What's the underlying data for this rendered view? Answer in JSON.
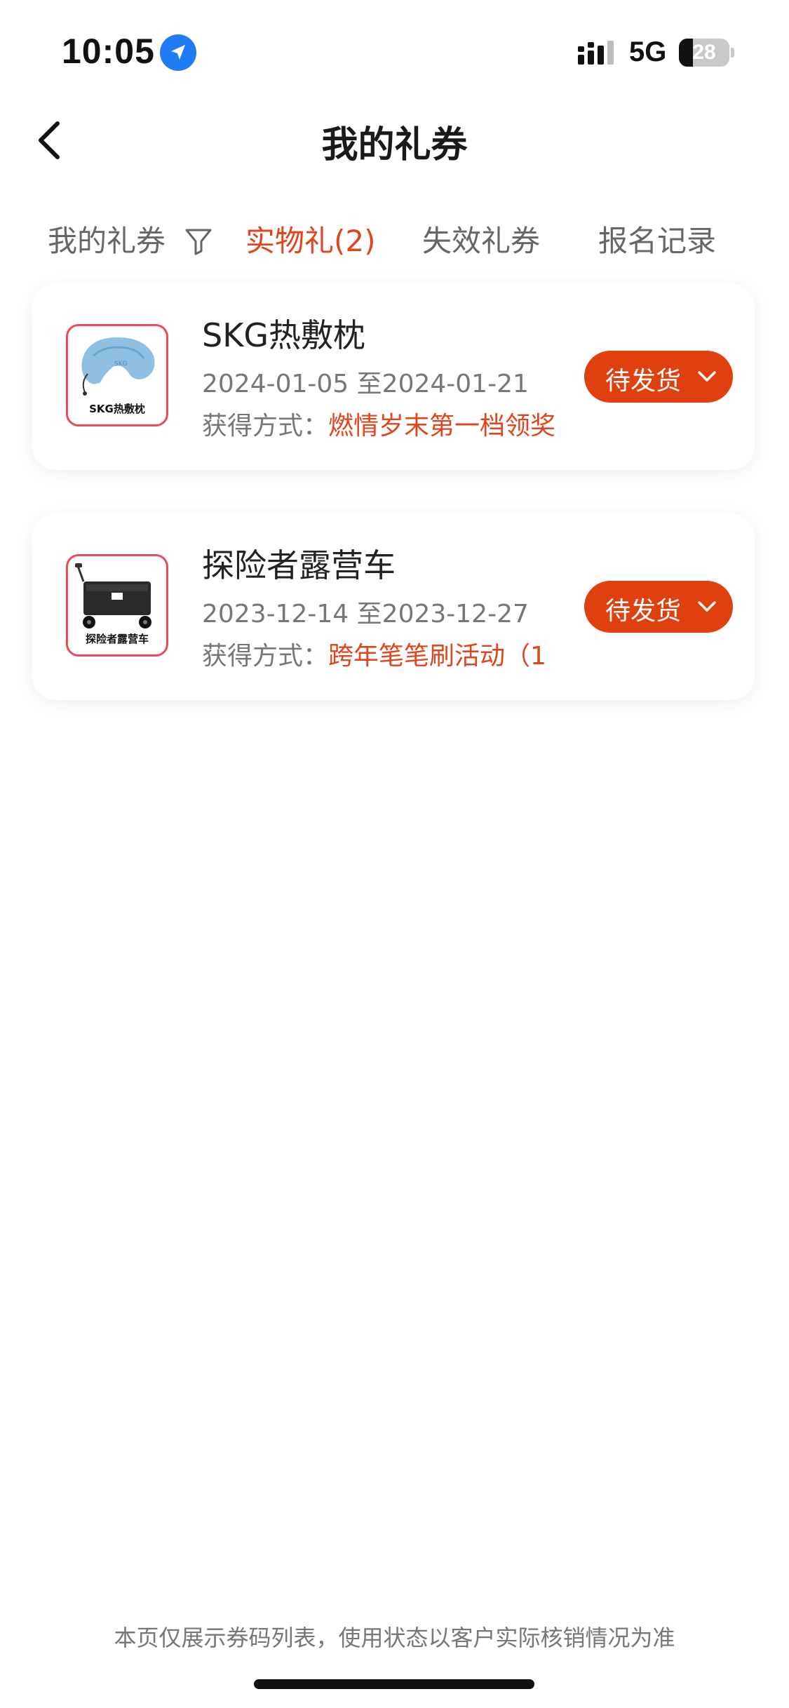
{
  "status_bar": {
    "time": "10:05",
    "network": "5G",
    "battery": "28",
    "battery_level": 0.28,
    "icons": [
      "location-arrow-icon",
      "signal-icon",
      "battery-icon"
    ]
  },
  "nav": {
    "title": "我的礼券",
    "back_icon": "chevron-left-icon"
  },
  "tabs": [
    {
      "label": "我的礼券",
      "active": false
    },
    {
      "label": "实物礼(2)",
      "active": true
    },
    {
      "label": "失效礼券",
      "active": false
    },
    {
      "label": "报名记录",
      "active": false
    }
  ],
  "filter_icon": "filter-funnel-icon",
  "gifts": [
    {
      "title": "SKG热敷枕",
      "thumb_label": "SKG热敷枕",
      "thumb_logo": "SKG",
      "date_range": "2024-01-05 至2024-01-21",
      "source_label": "获得方式：",
      "source_value": "燃情岁末第一档领奖",
      "status": "待发货"
    },
    {
      "title": "探险者露营车",
      "thumb_label": "探险者露营车",
      "date_range": "2023-12-14 至2023-12-27",
      "source_label": "获得方式：",
      "source_value": "跨年笔笔刷活动（1",
      "status": "待发货"
    }
  ],
  "footer": {
    "note": "本页仅展示券码列表，使用状态以客户实际核销情况为准"
  },
  "colors": {
    "accent": "#e0451e",
    "status_button": "#e0400e",
    "location_blue": "#1f7cf5"
  }
}
